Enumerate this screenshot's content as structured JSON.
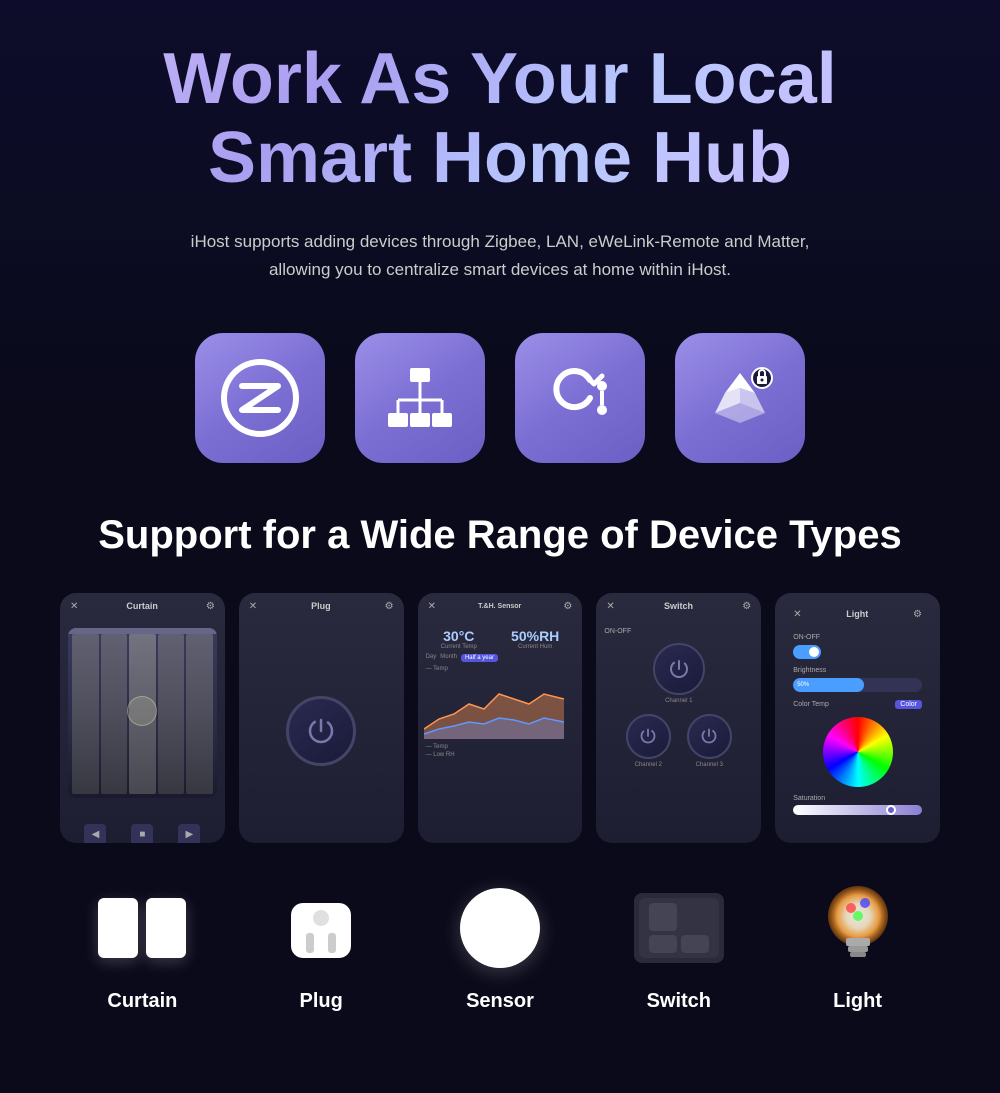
{
  "hero": {
    "title_line1": "Work As Your Local",
    "title_line2": "Smart Home Hub",
    "subtitle": "iHost supports adding devices through Zigbee, LAN, eWeLink-Remote and Matter, allowing you to centralize smart devices at home within iHost."
  },
  "protocols": [
    {
      "id": "zigbee",
      "name": "Zigbee",
      "symbol": "Z"
    },
    {
      "id": "lan",
      "name": "LAN",
      "symbol": "⬡"
    },
    {
      "id": "ewelink",
      "name": "eWeLink-Remote",
      "symbol": "C"
    },
    {
      "id": "matter",
      "name": "Matter",
      "symbol": "✳"
    }
  ],
  "section_title": "Support for a Wide Range of Device Types",
  "devices": [
    {
      "id": "curtain",
      "label": "Curtain",
      "card_title": "Curtain",
      "type": "curtain"
    },
    {
      "id": "plug",
      "label": "Plug",
      "card_title": "Plug",
      "type": "plug"
    },
    {
      "id": "sensor",
      "label": "Sensor",
      "card_title": "T.&H. Sensor",
      "type": "sensor",
      "temp": "30°C",
      "humidity": "50%RH"
    },
    {
      "id": "switch",
      "label": "Switch",
      "card_title": "Switch",
      "type": "switch"
    },
    {
      "id": "light",
      "label": "Light",
      "card_title": "Light",
      "type": "light"
    }
  ],
  "colors": {
    "primary_purple": "#8a7fd4",
    "dark_bg": "#0a0a1a",
    "card_bg": "#1a1a2e",
    "accent_blue": "#4a9eff"
  }
}
